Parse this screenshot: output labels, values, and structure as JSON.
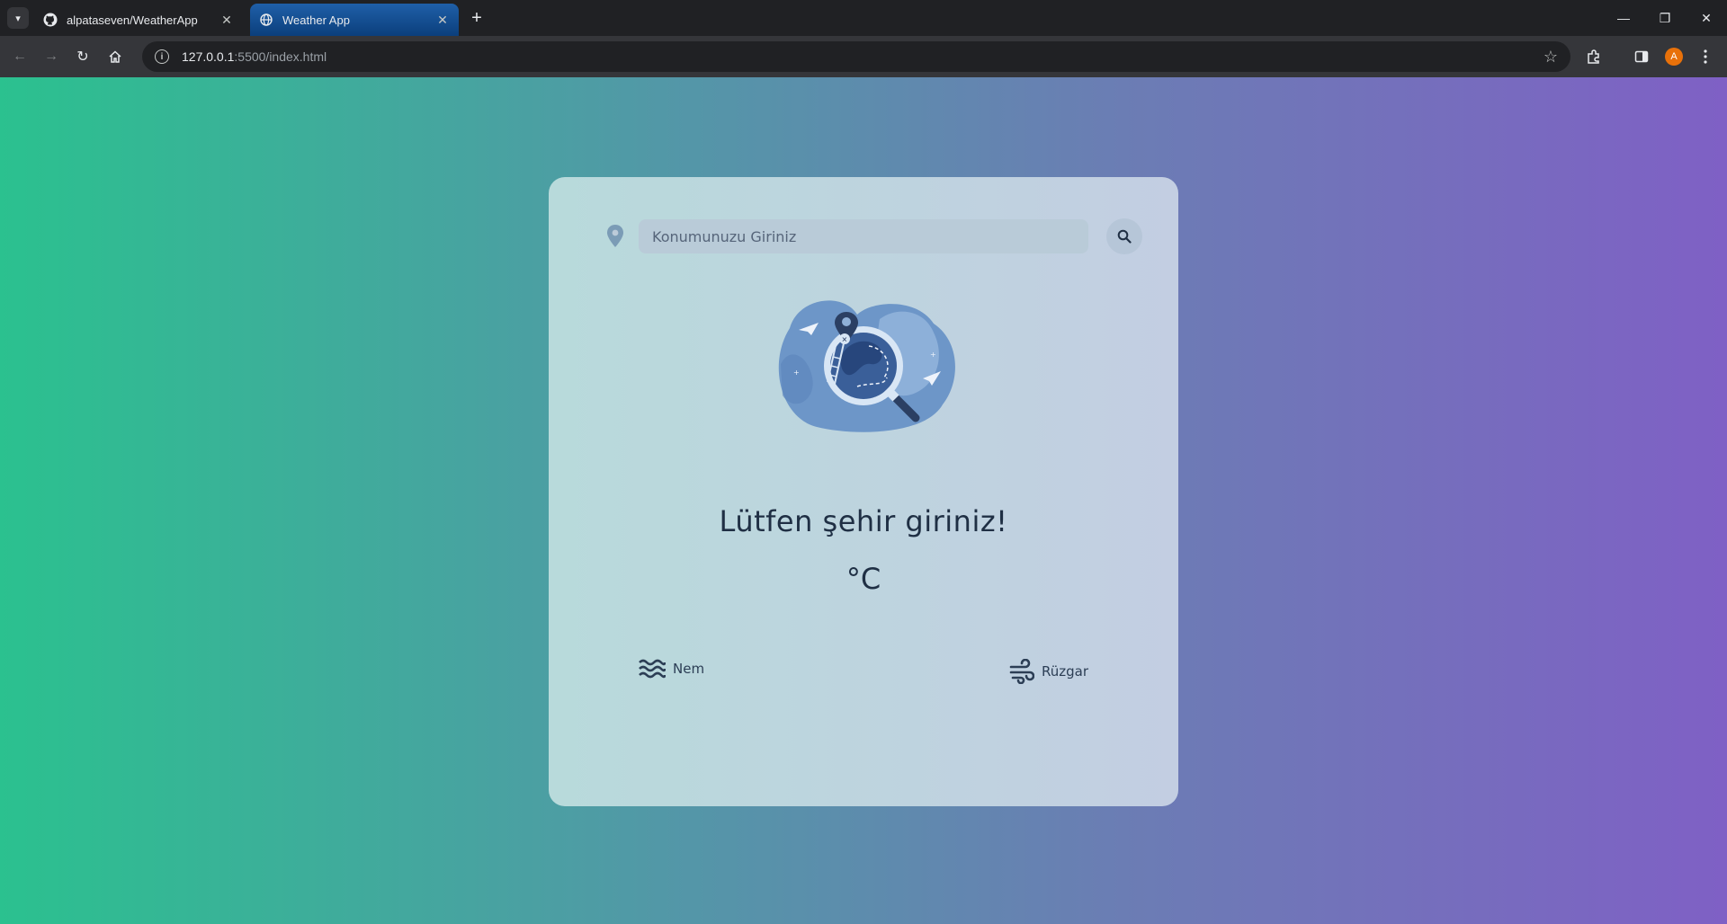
{
  "browser": {
    "tabs": [
      {
        "title": "alpataseven/WeatherApp",
        "favicon": "github-icon",
        "active": false
      },
      {
        "title": "Weather App",
        "favicon": "globe-icon",
        "active": true
      }
    ],
    "url_host": "127.0.0.1",
    "url_path": ":5500/index.html",
    "profile_initial": "A"
  },
  "app": {
    "search_placeholder": "Konumunuzu Giriniz",
    "city_message": "Lütfen şehir giriniz!",
    "temperature_unit": "°C",
    "humidity_label": "Nem",
    "wind_label": "Rüzgar"
  },
  "colors": {
    "bg_start": "#2bc18f",
    "bg_end": "#7f60c5",
    "card": "#c3cee2",
    "text": "#1f2f44"
  }
}
